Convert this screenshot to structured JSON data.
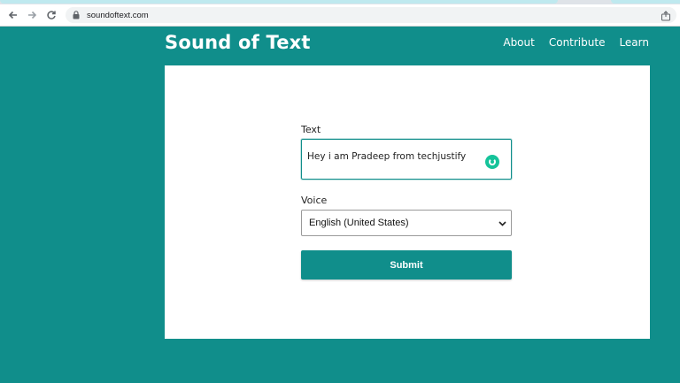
{
  "browser": {
    "url": "soundoftext.com",
    "icons": {
      "back": "arrow-left-icon",
      "forward": "arrow-right-icon",
      "reload": "reload-icon",
      "secure": "lock-icon",
      "share": "share-icon"
    }
  },
  "site": {
    "title": "Sound of Text",
    "nav": [
      {
        "label": "About"
      },
      {
        "label": "Contribute"
      },
      {
        "label": "Learn"
      }
    ]
  },
  "form": {
    "text_label": "Text",
    "text_value": "Hey i am Pradeep from techjustify",
    "voice_label": "Voice",
    "voice_selected": "English (United States)",
    "submit_label": "Submit"
  },
  "colors": {
    "brand_teal": "#108e8b",
    "card_bg": "#ffffff",
    "grammar_green": "#15c39a"
  }
}
